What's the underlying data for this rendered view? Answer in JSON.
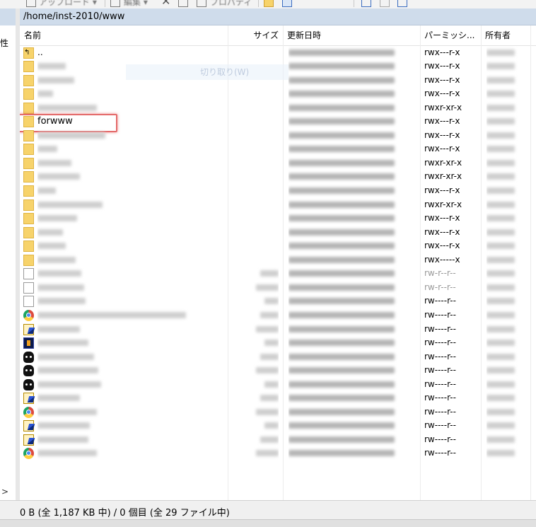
{
  "toolbar": {
    "items": [
      {
        "label": "アップロード ▾",
        "icon": "upload-icon"
      },
      {
        "label": "編集 ▾",
        "icon": "edit-icon"
      },
      {
        "label": "",
        "icon": "delete-icon"
      },
      {
        "label": "プロパティ",
        "icon": "properties-icon"
      },
      {
        "label": "",
        "icon": "new-folder-icon"
      },
      {
        "label": "",
        "icon": "new-file-icon"
      },
      {
        "label": "",
        "icon": "add-icon"
      },
      {
        "label": "",
        "icon": "blank-icon"
      },
      {
        "label": "",
        "icon": "filter-icon"
      }
    ]
  },
  "left_pane": {
    "column_label": "性",
    "scroll_arrow": ">"
  },
  "path": "/home/inst-2010/www",
  "columns": {
    "name": "名前",
    "size": "サイズ",
    "modified": "更新日時",
    "permissions": "パーミッシ...",
    "owner": "所有者"
  },
  "context_ghost": "切り取り(W)",
  "rows": [
    {
      "type": "parent",
      "icon": "parent-folder-icon",
      "name": "..",
      "permissions": "rwx---r-x"
    },
    {
      "type": "folder",
      "icon": "folder-icon",
      "name": "",
      "permissions": "rwx---r-x"
    },
    {
      "type": "folder",
      "icon": "folder-icon",
      "name": "",
      "permissions": "rwx---r-x"
    },
    {
      "type": "folder",
      "icon": "folder-icon",
      "name": "",
      "permissions": "rwx---r-x"
    },
    {
      "type": "folder",
      "icon": "folder-icon",
      "name": "",
      "permissions": "rwxr-xr-x"
    },
    {
      "type": "folder",
      "icon": "folder-icon",
      "name": "forwww",
      "permissions": "rwx---r-x",
      "highlighted": true
    },
    {
      "type": "folder",
      "icon": "folder-icon",
      "name": "",
      "permissions": "rwx---r-x"
    },
    {
      "type": "folder",
      "icon": "folder-icon",
      "name": "",
      "permissions": "rwx---r-x"
    },
    {
      "type": "folder",
      "icon": "folder-icon",
      "name": "",
      "permissions": "rwxr-xr-x"
    },
    {
      "type": "folder",
      "icon": "folder-icon",
      "name": "",
      "permissions": "rwxr-xr-x"
    },
    {
      "type": "folder",
      "icon": "folder-icon",
      "name": "",
      "permissions": "rwx---r-x"
    },
    {
      "type": "folder",
      "icon": "folder-icon",
      "name": "",
      "permissions": "rwxr-xr-x"
    },
    {
      "type": "folder",
      "icon": "folder-icon",
      "name": "",
      "permissions": "rwx---r-x"
    },
    {
      "type": "folder",
      "icon": "folder-icon",
      "name": "",
      "permissions": "rwx---r-x"
    },
    {
      "type": "folder",
      "icon": "folder-icon",
      "name": "",
      "permissions": "rwx---r-x"
    },
    {
      "type": "folder",
      "icon": "folder-icon",
      "name": "",
      "permissions": "rwx-----x"
    },
    {
      "type": "file",
      "icon": "document-icon",
      "name": "",
      "permissions": "rw-r--r--",
      "faded": true
    },
    {
      "type": "file",
      "icon": "document-icon",
      "name": "",
      "permissions": "rw-r--r--",
      "faded": true
    },
    {
      "type": "file",
      "icon": "document-icon",
      "name": "",
      "permissions": "rw----r--"
    },
    {
      "type": "file",
      "icon": "chrome-icon",
      "name": "",
      "permissions": "rw----r--"
    },
    {
      "type": "file",
      "icon": "editor-icon",
      "name": "",
      "permissions": "rw----r--"
    },
    {
      "type": "file",
      "icon": "image-file-icon",
      "name": "",
      "permissions": "rw----r--"
    },
    {
      "type": "file",
      "icon": "black-cat-icon",
      "name": "",
      "permissions": "rw----r--"
    },
    {
      "type": "file",
      "icon": "black-cat-icon",
      "name": "",
      "permissions": "rw----r--"
    },
    {
      "type": "file",
      "icon": "black-cat-icon",
      "name": "",
      "permissions": "rw----r--"
    },
    {
      "type": "file",
      "icon": "editor-icon",
      "name": "",
      "permissions": "rw----r--"
    },
    {
      "type": "file",
      "icon": "chrome-icon",
      "name": "",
      "permissions": "rw----r--"
    },
    {
      "type": "file",
      "icon": "editor-icon",
      "name": "",
      "permissions": "rw----r--"
    },
    {
      "type": "file",
      "icon": "editor-icon",
      "name": "",
      "permissions": "rw----r--"
    },
    {
      "type": "file",
      "icon": "chrome-icon",
      "name": "",
      "permissions": "rw----r--"
    }
  ],
  "status": "0 B (全 1,187 KB 中) / 0 個目 (全 29 ファイル中)",
  "colors": {
    "path_bar": "#cfdceb",
    "highlight": "#e46a6a",
    "folder": "#f7d36b"
  }
}
